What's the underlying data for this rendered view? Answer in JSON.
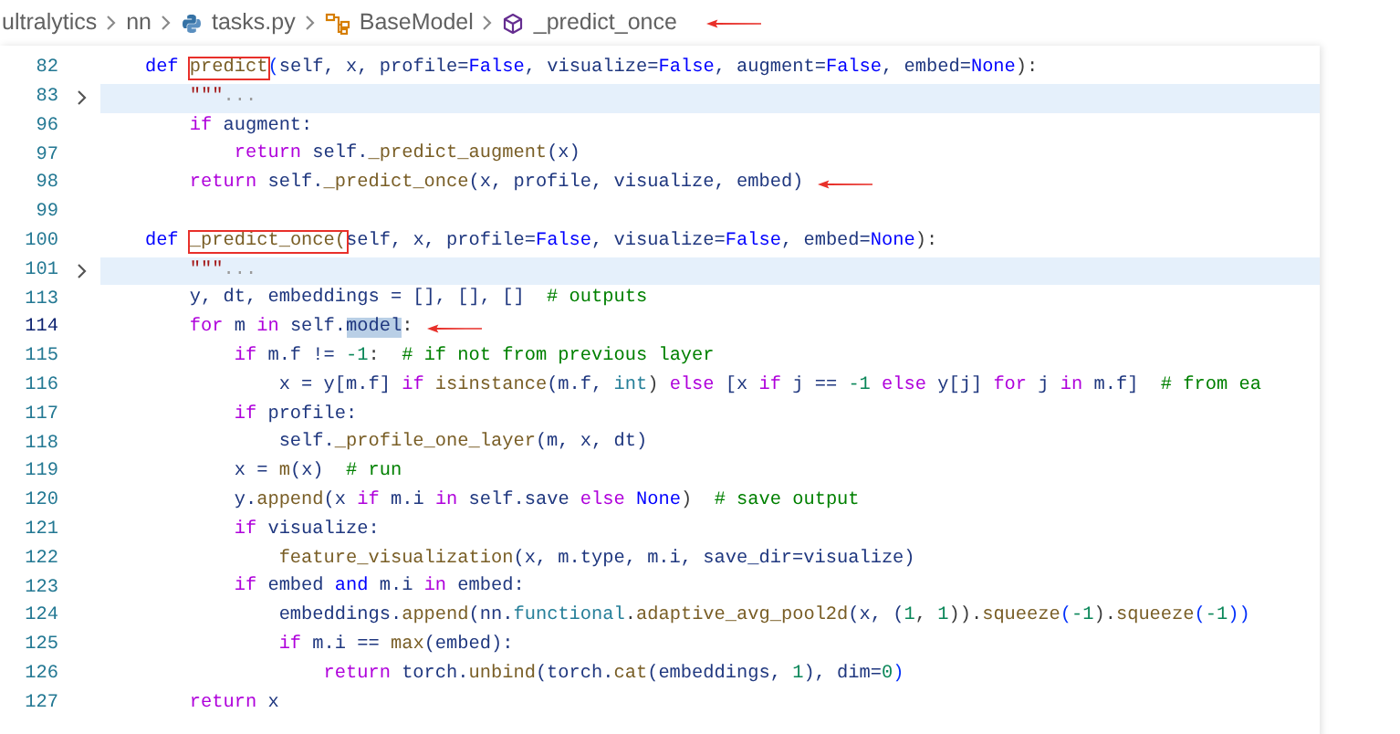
{
  "breadcrumb": {
    "arrow": true,
    "items": [
      {
        "label": "ultralytics",
        "kind": "folder"
      },
      {
        "label": "nn",
        "kind": "folder"
      },
      {
        "label": "tasks.py",
        "kind": "python"
      },
      {
        "label": "BaseModel",
        "kind": "class"
      },
      {
        "label": "_predict_once",
        "kind": "method"
      }
    ]
  },
  "lines": [
    {
      "number": "82",
      "folded": false,
      "current": false,
      "arrow": false,
      "tokens": [
        {
          "text": "    def ",
          "kind": "storage"
        },
        {
          "text": "predict",
          "kind": "fn",
          "boxed": true
        },
        {
          "text": "(",
          "kind": "paren"
        },
        {
          "text": "self, x, profile=",
          "kind": "var"
        },
        {
          "text": "False",
          "kind": "storage"
        },
        {
          "text": ", visualize=",
          "kind": "var"
        },
        {
          "text": "False",
          "kind": "storage"
        },
        {
          "text": ", augment=",
          "kind": "var"
        },
        {
          "text": "False",
          "kind": "storage"
        },
        {
          "text": ", embed=",
          "kind": "var"
        },
        {
          "text": "None",
          "kind": "storage"
        },
        {
          "text": "):",
          "kind": "plain"
        }
      ]
    },
    {
      "number": "83",
      "folded": true,
      "current": false,
      "arrow": false,
      "tokens": [
        {
          "text": "        \"\"\"",
          "kind": "string"
        },
        {
          "text": "...",
          "kind": "ellipsis"
        }
      ]
    },
    {
      "number": "96",
      "folded": false,
      "current": false,
      "arrow": false,
      "tokens": [
        {
          "text": "        if",
          "kind": "keyword"
        },
        {
          "text": " augment:",
          "kind": "var"
        }
      ]
    },
    {
      "number": "97",
      "folded": false,
      "current": false,
      "arrow": false,
      "tokens": [
        {
          "text": "            return",
          "kind": "keyword"
        },
        {
          "text": " self.",
          "kind": "var"
        },
        {
          "text": "_predict_augment",
          "kind": "fn"
        },
        {
          "text": "(x)",
          "kind": "var"
        }
      ]
    },
    {
      "number": "98",
      "folded": false,
      "current": false,
      "arrow": true,
      "tokens": [
        {
          "text": "        return",
          "kind": "keyword"
        },
        {
          "text": " self.",
          "kind": "var"
        },
        {
          "text": "_predict_once",
          "kind": "fn"
        },
        {
          "text": "(x, profile, visualize, embed)",
          "kind": "var"
        }
      ]
    },
    {
      "number": "99",
      "folded": false,
      "current": false,
      "arrow": false
    },
    {
      "number": "100",
      "folded": false,
      "current": false,
      "arrow": false,
      "tokens": [
        {
          "text": "    def ",
          "kind": "storage"
        },
        {
          "text": "_predict_once(",
          "kind": "fn",
          "boxed": true
        },
        {
          "text": "self, x, profile=",
          "kind": "var"
        },
        {
          "text": "False",
          "kind": "storage"
        },
        {
          "text": ", visualize=",
          "kind": "var"
        },
        {
          "text": "False",
          "kind": "storage"
        },
        {
          "text": ", embed=",
          "kind": "var"
        },
        {
          "text": "None",
          "kind": "storage"
        },
        {
          "text": "):",
          "kind": "plain"
        }
      ]
    },
    {
      "number": "101",
      "folded": true,
      "current": false,
      "arrow": false,
      "tokens": [
        {
          "text": "        \"\"\"",
          "kind": "string"
        },
        {
          "text": "...",
          "kind": "ellipsis"
        }
      ]
    },
    {
      "number": "113",
      "folded": false,
      "current": false,
      "arrow": false,
      "tokens": [
        {
          "text": "        y, dt, embeddings = [], [], []  ",
          "kind": "var"
        },
        {
          "text": "# outputs",
          "kind": "comment"
        }
      ]
    },
    {
      "number": "114",
      "folded": false,
      "current": true,
      "arrow": true,
      "tokens": [
        {
          "text": "        for",
          "kind": "keyword"
        },
        {
          "text": " m ",
          "kind": "var"
        },
        {
          "text": "in",
          "kind": "keyword"
        },
        {
          "text": " self.",
          "kind": "var"
        },
        {
          "text": "model",
          "kind": "var",
          "selected": true
        },
        {
          "text": ":",
          "kind": "plain"
        }
      ]
    },
    {
      "number": "115",
      "folded": false,
      "current": false,
      "arrow": false,
      "tokens": [
        {
          "text": "            if",
          "kind": "keyword"
        },
        {
          "text": " m.f != ",
          "kind": "var"
        },
        {
          "text": "-1",
          "kind": "number"
        },
        {
          "text": ":  ",
          "kind": "plain"
        },
        {
          "text": "# if not from previous layer",
          "kind": "comment"
        }
      ]
    },
    {
      "number": "116",
      "folded": false,
      "current": false,
      "arrow": false,
      "tokens": [
        {
          "text": "                x = y[m.f] ",
          "kind": "var"
        },
        {
          "text": "if",
          "kind": "keyword"
        },
        {
          "text": " isinstance",
          "kind": "fn"
        },
        {
          "text": "(m.f, ",
          "kind": "var"
        },
        {
          "text": "int",
          "kind": "type"
        },
        {
          "text": ") ",
          "kind": "plain"
        },
        {
          "text": "else",
          "kind": "keyword"
        },
        {
          "text": " [x ",
          "kind": "var"
        },
        {
          "text": "if",
          "kind": "keyword"
        },
        {
          "text": " j == ",
          "kind": "var"
        },
        {
          "text": "-1",
          "kind": "number"
        },
        {
          "text": " else",
          "kind": "keyword"
        },
        {
          "text": " y[j] ",
          "kind": "var"
        },
        {
          "text": "for",
          "kind": "keyword"
        },
        {
          "text": " j ",
          "kind": "var"
        },
        {
          "text": "in",
          "kind": "keyword"
        },
        {
          "text": " m.f]  ",
          "kind": "var"
        },
        {
          "text": "# from ea",
          "kind": "comment"
        }
      ]
    },
    {
      "number": "117",
      "folded": false,
      "current": false,
      "arrow": false,
      "tokens": [
        {
          "text": "            if",
          "kind": "keyword"
        },
        {
          "text": " profile:",
          "kind": "var"
        }
      ]
    },
    {
      "number": "118",
      "folded": false,
      "current": false,
      "arrow": false,
      "tokens": [
        {
          "text": "                self.",
          "kind": "var"
        },
        {
          "text": "_profile_one_layer",
          "kind": "fn"
        },
        {
          "text": "(m, x, dt)",
          "kind": "var"
        }
      ]
    },
    {
      "number": "119",
      "folded": false,
      "current": false,
      "arrow": false,
      "tokens": [
        {
          "text": "            x = ",
          "kind": "var"
        },
        {
          "text": "m",
          "kind": "fn"
        },
        {
          "text": "(x)  ",
          "kind": "var"
        },
        {
          "text": "# run",
          "kind": "comment"
        }
      ]
    },
    {
      "number": "120",
      "folded": false,
      "current": false,
      "arrow": false,
      "tokens": [
        {
          "text": "            y.",
          "kind": "var"
        },
        {
          "text": "append",
          "kind": "fn"
        },
        {
          "text": "(x ",
          "kind": "var"
        },
        {
          "text": "if",
          "kind": "keyword"
        },
        {
          "text": " m.i ",
          "kind": "var"
        },
        {
          "text": "in",
          "kind": "keyword"
        },
        {
          "text": " self.save ",
          "kind": "var"
        },
        {
          "text": "else",
          "kind": "keyword"
        },
        {
          "text": " None",
          "kind": "storage"
        },
        {
          "text": ")  ",
          "kind": "plain"
        },
        {
          "text": "# save output",
          "kind": "comment"
        }
      ]
    },
    {
      "number": "121",
      "folded": false,
      "current": false,
      "arrow": false,
      "tokens": [
        {
          "text": "            if",
          "kind": "keyword"
        },
        {
          "text": " visualize:",
          "kind": "var"
        }
      ]
    },
    {
      "number": "122",
      "folded": false,
      "current": false,
      "arrow": false,
      "tokens": [
        {
          "text": "                feature_visualization",
          "kind": "fn"
        },
        {
          "text": "(x, m.type, m.i, save_dir=visualize)",
          "kind": "var"
        }
      ]
    },
    {
      "number": "123",
      "folded": false,
      "current": false,
      "arrow": false,
      "tokens": [
        {
          "text": "            if",
          "kind": "keyword"
        },
        {
          "text": " embed ",
          "kind": "var"
        },
        {
          "text": "and",
          "kind": "storage"
        },
        {
          "text": " m.i ",
          "kind": "var"
        },
        {
          "text": "in",
          "kind": "keyword"
        },
        {
          "text": " embed:",
          "kind": "var"
        }
      ]
    },
    {
      "number": "124",
      "folded": false,
      "current": false,
      "arrow": false,
      "tokens": [
        {
          "text": "                embeddings.",
          "kind": "var"
        },
        {
          "text": "append",
          "kind": "fn"
        },
        {
          "text": "(nn.",
          "kind": "var"
        },
        {
          "text": "functional",
          "kind": "type"
        },
        {
          "text": ".",
          "kind": "plain"
        },
        {
          "text": "adaptive_avg_pool2d",
          "kind": "fn"
        },
        {
          "text": "(x, (",
          "kind": "var"
        },
        {
          "text": "1",
          "kind": "number"
        },
        {
          "text": ", ",
          "kind": "plain"
        },
        {
          "text": "1",
          "kind": "number"
        },
        {
          "text": ")).",
          "kind": "plain"
        },
        {
          "text": "squeeze",
          "kind": "fn"
        },
        {
          "text": "(",
          "kind": "paren"
        },
        {
          "text": "-1",
          "kind": "number"
        },
        {
          "text": ").",
          "kind": "plain"
        },
        {
          "text": "squeeze",
          "kind": "fn"
        },
        {
          "text": "(",
          "kind": "paren"
        },
        {
          "text": "-1",
          "kind": "number"
        },
        {
          "text": "))",
          "kind": "paren"
        }
      ]
    },
    {
      "number": "125",
      "folded": false,
      "current": false,
      "arrow": false,
      "tokens": [
        {
          "text": "                if",
          "kind": "keyword"
        },
        {
          "text": " m.i == ",
          "kind": "var"
        },
        {
          "text": "max",
          "kind": "fn"
        },
        {
          "text": "(embed):",
          "kind": "var"
        }
      ]
    },
    {
      "number": "126",
      "folded": false,
      "current": false,
      "arrow": false,
      "tokens": [
        {
          "text": "                    return",
          "kind": "keyword"
        },
        {
          "text": " torch.",
          "kind": "var"
        },
        {
          "text": "unbind",
          "kind": "fn"
        },
        {
          "text": "(torch.",
          "kind": "var"
        },
        {
          "text": "cat",
          "kind": "fn"
        },
        {
          "text": "(embeddings, ",
          "kind": "var"
        },
        {
          "text": "1",
          "kind": "number"
        },
        {
          "text": "), dim=",
          "kind": "var"
        },
        {
          "text": "0",
          "kind": "number"
        },
        {
          "text": ")",
          "kind": "paren"
        }
      ]
    },
    {
      "number": "127",
      "folded": false,
      "current": false,
      "arrow": false,
      "tokens": [
        {
          "text": "        return",
          "kind": "keyword"
        },
        {
          "text": " x",
          "kind": "var"
        }
      ]
    }
  ]
}
